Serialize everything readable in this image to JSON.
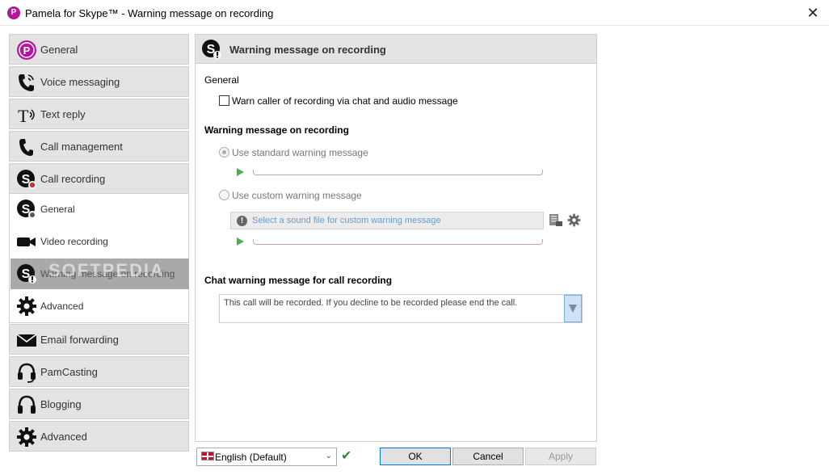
{
  "window": {
    "title": "Pamela for Skype™ - Warning message on recording",
    "app_icon_letter": "P",
    "close_glyph": "✕"
  },
  "sidebar": {
    "items": [
      {
        "label": "General",
        "icon": "pamela-logo-icon"
      },
      {
        "label": "Voice messaging",
        "icon": "phone-waves-icon"
      },
      {
        "label": "Text reply",
        "icon": "text-reply-icon"
      },
      {
        "label": "Call management",
        "icon": "phone-icon"
      },
      {
        "label": "Call recording",
        "icon": "skype-record-icon"
      }
    ],
    "sub_items": [
      {
        "label": "General",
        "icon": "skype-gear-icon"
      },
      {
        "label": "Video recording",
        "icon": "video-camera-icon"
      },
      {
        "label": "Warning message on recording",
        "icon": "skype-warning-icon",
        "selected": true
      },
      {
        "label": "Advanced",
        "icon": "gear-icon"
      }
    ],
    "bottom_items": [
      {
        "label": "Email forwarding",
        "icon": "envelope-icon"
      },
      {
        "label": "PamCasting",
        "icon": "headset-icon"
      },
      {
        "label": "Blogging",
        "icon": "headphones-icon"
      },
      {
        "label": "Advanced",
        "icon": "gear-icon"
      }
    ]
  },
  "main": {
    "header": "Warning message on recording",
    "general_label": "General",
    "warn_checkbox_label": "Warn caller of recording via chat and audio message",
    "warn_checked": false,
    "section_warning": "Warning message on recording",
    "radio_standard": "Use standard warning message",
    "radio_custom": "Use custom warning message",
    "standard_selected": true,
    "file_placeholder": "Select a sound file for custom warning message",
    "section_chat": "Chat warning message for call recording",
    "chat_message": "This call will be recorded. If you decline to be recorded please end the call."
  },
  "footer": {
    "language": "English (Default)",
    "ok": "OK",
    "cancel": "Cancel",
    "apply": "Apply"
  },
  "watermark": "SOFTPEDIA",
  "colors": {
    "accent": "#b3169b",
    "play": "#4caf50",
    "link": "#6b9bc9",
    "selected_nav": "#a9a9a9"
  }
}
